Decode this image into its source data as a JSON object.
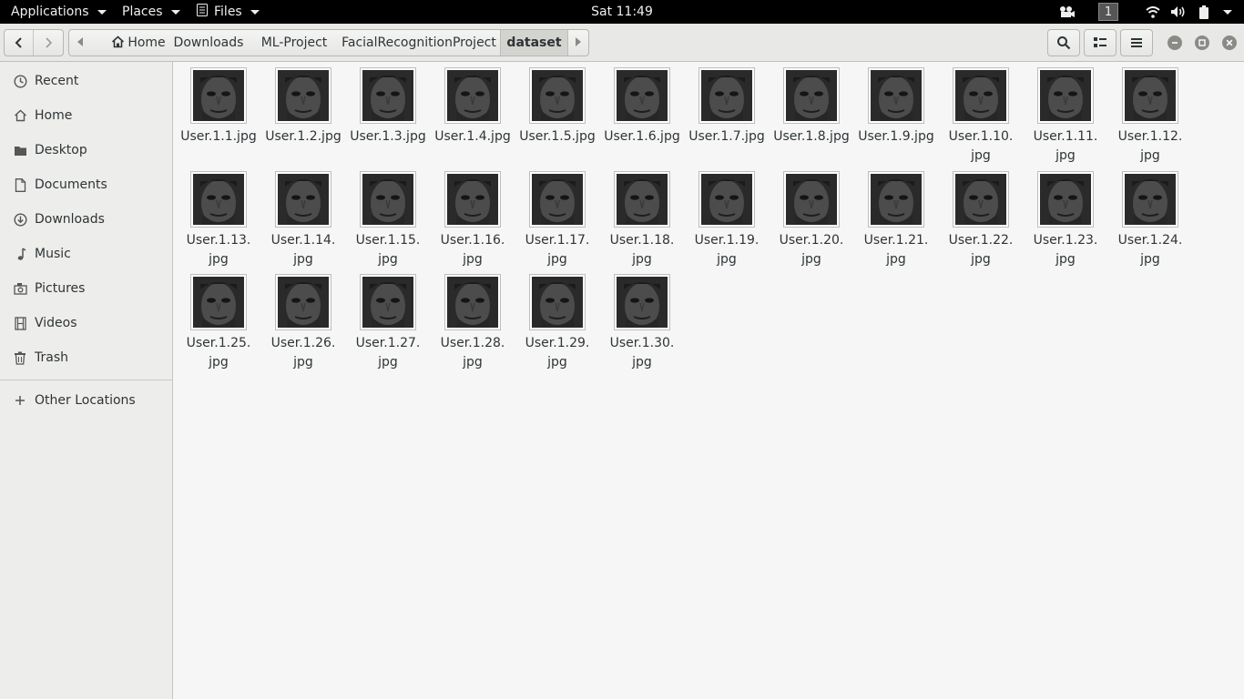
{
  "topbar": {
    "applications_label": "Applications",
    "places_label": "Places",
    "files_label": "Files",
    "clock": "Sat 11:49",
    "workspace": "1"
  },
  "pathbar": {
    "crumbs": [
      "Home",
      "Downloads",
      "ML-Project",
      "FacialRecognitionProject",
      "dataset"
    ]
  },
  "sidebar": {
    "items": [
      {
        "label": "Recent",
        "icon": "clock-icon"
      },
      {
        "label": "Home",
        "icon": "home-icon"
      },
      {
        "label": "Desktop",
        "icon": "folder-icon"
      },
      {
        "label": "Documents",
        "icon": "document-icon"
      },
      {
        "label": "Downloads",
        "icon": "download-icon"
      },
      {
        "label": "Music",
        "icon": "music-icon"
      },
      {
        "label": "Pictures",
        "icon": "camera-icon"
      },
      {
        "label": "Videos",
        "icon": "film-icon"
      },
      {
        "label": "Trash",
        "icon": "trash-icon"
      }
    ],
    "other_locations": "Other Locations"
  },
  "files": [
    {
      "line1": "User.1.1.jpg",
      "line2": ""
    },
    {
      "line1": "User.1.2.jpg",
      "line2": ""
    },
    {
      "line1": "User.1.3.jpg",
      "line2": ""
    },
    {
      "line1": "User.1.4.jpg",
      "line2": ""
    },
    {
      "line1": "User.1.5.jpg",
      "line2": ""
    },
    {
      "line1": "User.1.6.jpg",
      "line2": ""
    },
    {
      "line1": "User.1.7.jpg",
      "line2": ""
    },
    {
      "line1": "User.1.8.jpg",
      "line2": ""
    },
    {
      "line1": "User.1.9.jpg",
      "line2": ""
    },
    {
      "line1": "User.1.10.",
      "line2": "jpg"
    },
    {
      "line1": "User.1.11.",
      "line2": "jpg"
    },
    {
      "line1": "User.1.12.",
      "line2": "jpg"
    },
    {
      "line1": "User.1.13.",
      "line2": "jpg"
    },
    {
      "line1": "User.1.14.",
      "line2": "jpg"
    },
    {
      "line1": "User.1.15.",
      "line2": "jpg"
    },
    {
      "line1": "User.1.16.",
      "line2": "jpg"
    },
    {
      "line1": "User.1.17.",
      "line2": "jpg"
    },
    {
      "line1": "User.1.18.",
      "line2": "jpg"
    },
    {
      "line1": "User.1.19.",
      "line2": "jpg"
    },
    {
      "line1": "User.1.20.",
      "line2": "jpg"
    },
    {
      "line1": "User.1.21.",
      "line2": "jpg"
    },
    {
      "line1": "User.1.22.",
      "line2": "jpg"
    },
    {
      "line1": "User.1.23.",
      "line2": "jpg"
    },
    {
      "line1": "User.1.24.",
      "line2": "jpg"
    },
    {
      "line1": "User.1.25.",
      "line2": "jpg"
    },
    {
      "line1": "User.1.26.",
      "line2": "jpg"
    },
    {
      "line1": "User.1.27.",
      "line2": "jpg"
    },
    {
      "line1": "User.1.28.",
      "line2": "jpg"
    },
    {
      "line1": "User.1.29.",
      "line2": "jpg"
    },
    {
      "line1": "User.1.30.",
      "line2": "jpg"
    }
  ]
}
